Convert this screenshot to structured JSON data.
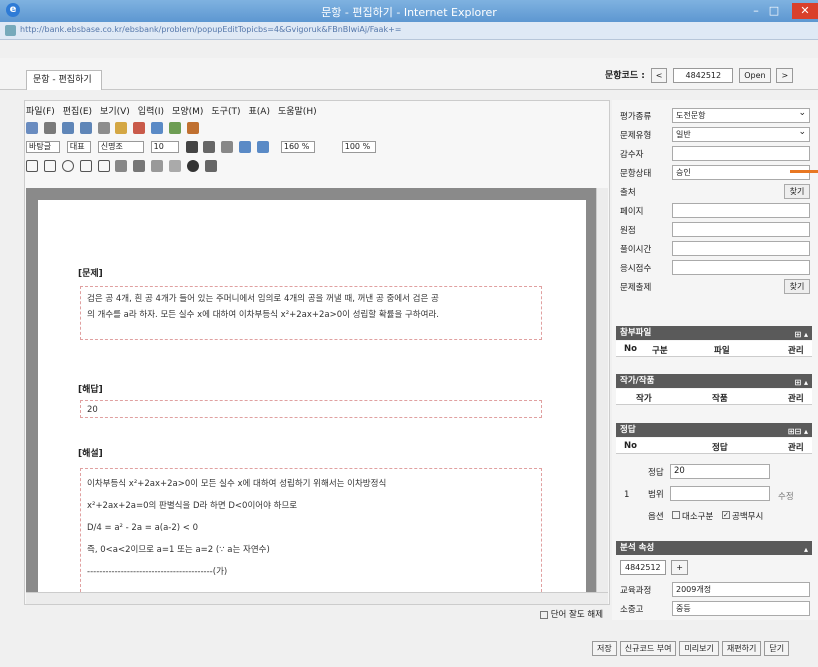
{
  "window": {
    "title": "문항 - 편집하기 - Internet Explorer",
    "url": "http://bank.ebsbase.co.kr/ebsbank/problem/popupEditTopicbs=4&Gvigoruk&FBnBIwiAj/Faak+="
  },
  "tab": {
    "label": "문항 - 편집하기"
  },
  "code_bar": {
    "label": "문항코드 :",
    "value": "4842512",
    "open_label": "Open",
    "prev": "<",
    "next": ">"
  },
  "menu": [
    "파일(F)",
    "편집(E)",
    "보기(V)",
    "입력(I)",
    "모양(M)",
    "도구(T)",
    "표(A)",
    "도움말(H)"
  ],
  "toolbar": {
    "font_name": "바탕글",
    "font_style": "대표",
    "font_face": "신명조",
    "font_size": "10",
    "zoom1": "160 %",
    "zoom2": "100 %"
  },
  "document": {
    "problem_heading": "[문제]",
    "problem_line1": "검은 공 4개, 흰 공 4개가 들어 있는 주머니에서 임의로 4개의 공을 꺼낼 때, 꺼낸 공 중에서 검은 공",
    "problem_line2": "의 개수를 a라 하자. 모든 실수 x에 대하여 이차부등식 x²+2ax+2a>0이 성립할 확률을 구하여라.",
    "answer_heading": "[해답]",
    "answer_value": "20",
    "solution_heading": "[해설]",
    "solution_lines": [
      "이차부등식 x²+2ax+2a>0이 모든 실수 x에 대하여 성립하기 위해서는 이차방정식",
      "x²+2ax+2a=0의 판별식을 D라 하면 D<0이어야 하므로",
      "D/4 = a² - 2a = a(a-2) < 0",
      "즉, 0<a<2이므로 a=1 또는 a=2 (∵ a는 자연수)",
      "-----------------------------------------(가)"
    ],
    "view_mode_label": "단어 잘도 해제"
  },
  "fields": [
    {
      "label": "평가종류",
      "value": "도전문항",
      "type": "select"
    },
    {
      "label": "문제유형",
      "value": "일반",
      "type": "select"
    },
    {
      "label": "감수자",
      "value": "",
      "type": "input"
    },
    {
      "label": "문항상태",
      "value": "승인",
      "type": "input"
    },
    {
      "label": "출처",
      "value": "",
      "type": "button",
      "button": "찾기"
    },
    {
      "label": "페이지",
      "value": "",
      "type": "input"
    },
    {
      "label": "원점",
      "value": "",
      "type": "input"
    },
    {
      "label": "풀이시간",
      "value": "",
      "type": "input"
    },
    {
      "label": "응시점수",
      "value": "",
      "type": "input"
    },
    {
      "label": "문제출제",
      "value": "",
      "type": "button",
      "button": "찾기"
    }
  ],
  "panels": {
    "related": {
      "title": "참부파일",
      "cols": [
        "No",
        "구분",
        "파일",
        "관리"
      ]
    },
    "author": {
      "title": "작가/작품",
      "cols": [
        "작가",
        "작품",
        "관리"
      ]
    },
    "answer": {
      "title": "정답",
      "cols": [
        "No",
        "정답",
        "관리"
      ],
      "row_no": "1",
      "answer_label": "정답",
      "answer_value": "20",
      "range_label": "범위",
      "option_label": "옵션",
      "opt1": "대소구분",
      "opt2": "공백무시",
      "manage": "수정"
    },
    "attrs": {
      "title": "분석 속성",
      "code": "4842512",
      "rows": [
        {
          "label": "교육과정",
          "value": "2009개정"
        },
        {
          "label": "소중고",
          "value": "중등"
        }
      ]
    }
  },
  "footer_buttons": [
    "저장",
    "신규코드 부여",
    "미리보기",
    "재편하기",
    "닫기"
  ]
}
